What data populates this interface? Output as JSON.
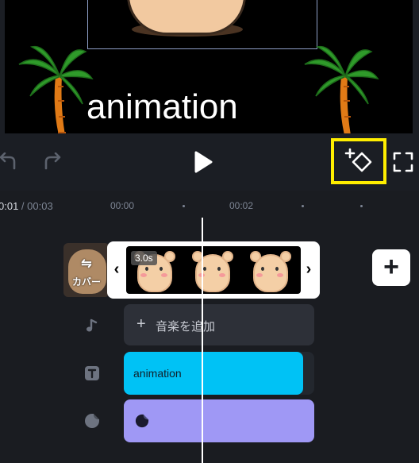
{
  "preview": {
    "overlay_text": "animation"
  },
  "toolbar": {
    "undo_icon": "undo-icon",
    "redo_icon": "redo-icon",
    "play_icon": "play-icon",
    "keyframe_icon": "add-keyframe-icon",
    "fullscreen_icon": "fullscreen-icon",
    "highlight_color": "#ffee00"
  },
  "timeline": {
    "current_time": "0:01",
    "total_time": " / 00:03",
    "ticks": [
      "00:00",
      "00:02"
    ],
    "cover_label": "カバー",
    "clip_duration": "3.0s",
    "add_clip_label": "+",
    "music_plus": "+",
    "music_label": "音楽を追加",
    "text_track_label": "animation",
    "colors": {
      "text_track": "#00c2f5",
      "sticker_track": "#9f98f5",
      "music_track": "#2d3038"
    }
  }
}
